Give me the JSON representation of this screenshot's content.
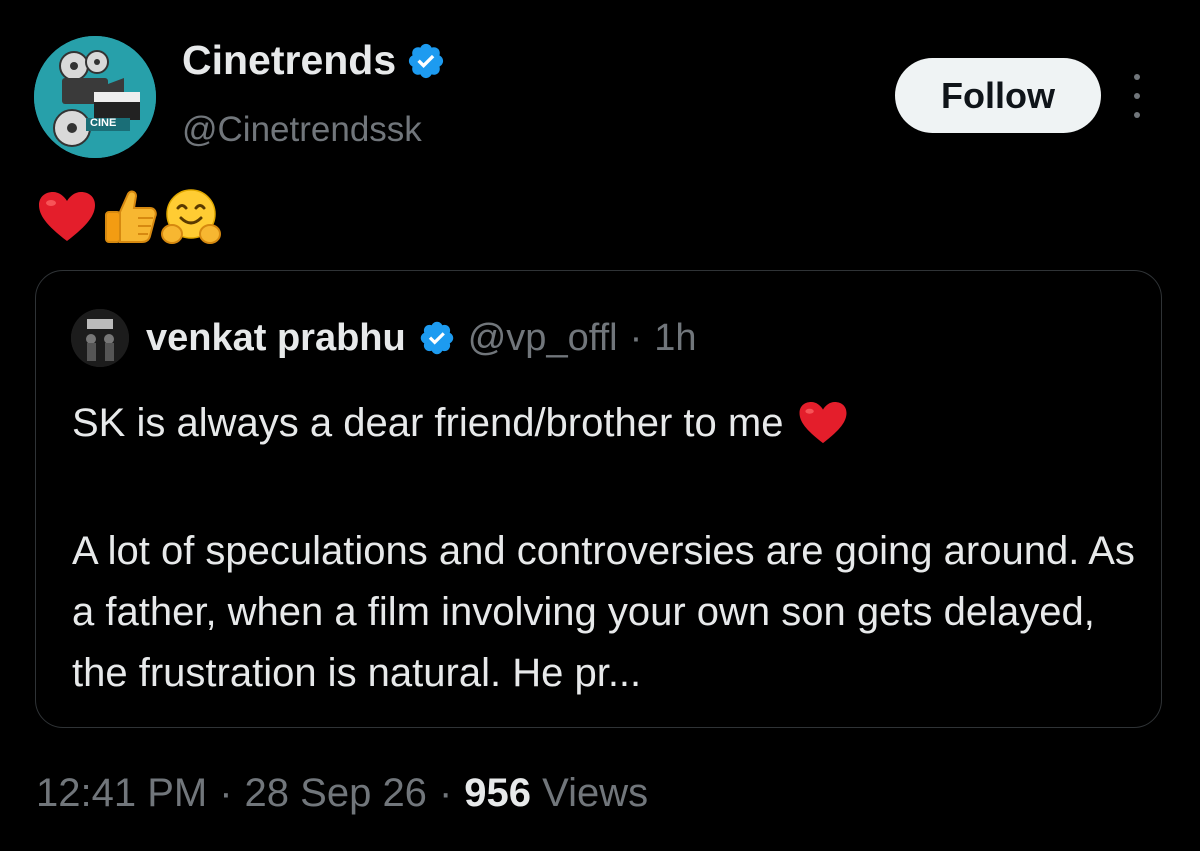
{
  "author": {
    "name": "Cinetrends",
    "handle": "@Cinetrendssk",
    "verified": true,
    "avatar_text": "CINE",
    "avatar_color": "#27a0aa"
  },
  "follow_button": {
    "label": "Follow"
  },
  "more_icon": "more-vertical-icon",
  "post": {
    "emojis": [
      "red-heart-emoji",
      "thumbs-up-emoji",
      "hugging-face-emoji"
    ]
  },
  "quoted_tweet": {
    "author_name": "venkat prabhu",
    "handle": "@vp_offl",
    "separator": "·",
    "time": "1h",
    "verified": true,
    "line1": "SK is always a dear friend/brother to me",
    "paragraph": "A lot of speculations and controversies are going around. As a father, when a film involving your own son gets delayed, the frustration is natural. He pr..."
  },
  "meta": {
    "time": "12:41 PM",
    "sep1": "·",
    "date": "28 Sep 26",
    "sep2": "·",
    "views_count": "956",
    "views_label": "Views"
  },
  "colors": {
    "background": "#000000",
    "text_primary": "#e7e9ea",
    "text_secondary": "#71767b",
    "verified_blue": "#1d9bf0",
    "border": "#2f3336"
  }
}
